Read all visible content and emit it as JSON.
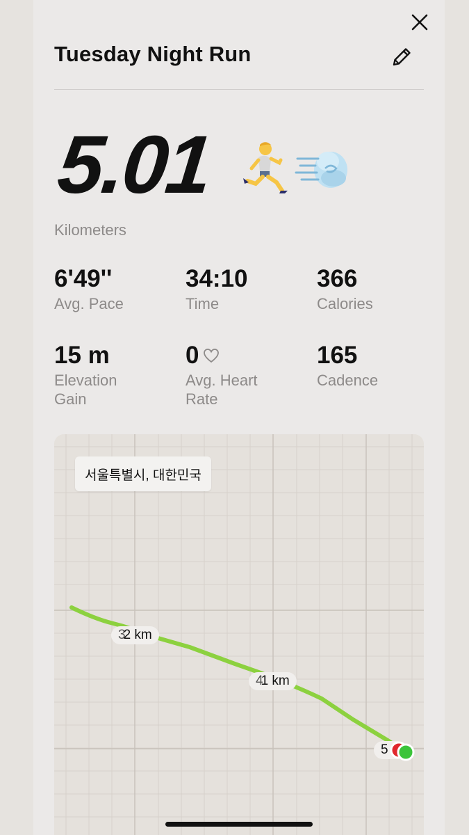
{
  "header": {
    "title": "Tuesday Night Run"
  },
  "icons": {
    "close": "close-icon",
    "edit": "pencil-icon",
    "heart": "heart-outline-icon",
    "runner": "runner-emoji",
    "dash": "dash-emoji"
  },
  "summary": {
    "distance": "5.01",
    "unit": "Kilometers",
    "emoji_runner": "🏃",
    "emoji_dash": "💨"
  },
  "stats": [
    {
      "value": "6'49''",
      "label": "Avg. Pace"
    },
    {
      "value": "34:10",
      "label": "Time"
    },
    {
      "value": "366",
      "label": "Calories"
    },
    {
      "value": "15 m",
      "label": "Elevation Gain"
    },
    {
      "value": "0",
      "label": "Avg. Heart Rate"
    },
    {
      "value": "165",
      "label": "Cadence"
    }
  ],
  "map": {
    "location": "서울특별시, 대한민국",
    "markers": [
      {
        "ghost": "3",
        "label": "2 km"
      },
      {
        "ghost": "4",
        "label": "1 km"
      },
      {
        "label": "5"
      }
    ],
    "route_color": "#8cd13f",
    "start_color": "#3cc43a",
    "end_color": "#e0282e"
  }
}
